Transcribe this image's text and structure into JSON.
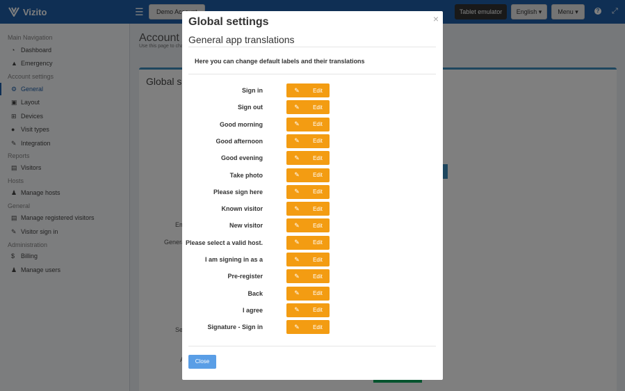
{
  "header": {
    "brand": "Vizito",
    "demo_label": "Demo Account",
    "tablet_label": "Tablet emulator",
    "language_label": "English",
    "menu_label": "Menu"
  },
  "sidebar": {
    "main_nav_heading": "Main Navigation",
    "dashboard": "Dashboard",
    "emergency": "Emergency",
    "account_heading": "Account settings",
    "general": "General",
    "layout": "Layout",
    "devices": "Devices",
    "visit_types": "Visit types",
    "integration": "Integration",
    "reports_heading": "Reports",
    "visitors": "Visitors",
    "hosts_heading": "Hosts",
    "manage_hosts": "Manage hosts",
    "general_heading": "General",
    "manage_registered": "Manage registered visitors",
    "visitor_sign_in": "Visitor sign in",
    "admin_heading": "Administration",
    "billing": "Billing",
    "manage_users": "Manage users"
  },
  "content": {
    "title": "Account",
    "subtitle": "Use this page to cha",
    "box_title": "Global set",
    "label_em": "Em",
    "label_genera": "Genera",
    "label_sel": "Sel",
    "label_a": "A"
  },
  "modal": {
    "title": "Global settings",
    "close_glyph": "×",
    "subtitle": "General app translations",
    "description": "Here you can change default labels and their translations",
    "edit_label": "Edit",
    "close_button": "Close",
    "rows": [
      "Sign in",
      "Sign out",
      "Good morning",
      "Good afternoon",
      "Good evening",
      "Take photo",
      "Please sign here",
      "Known visitor",
      "New visitor",
      "Please select a valid host.",
      "I am signing in as a",
      "Pre-register",
      "Back",
      "I agree",
      "Signature - Sign in"
    ]
  },
  "colors": {
    "header_blue": "#1e5fa8",
    "edit_orange": "#f39c12",
    "close_blue": "#5a9ee6"
  }
}
